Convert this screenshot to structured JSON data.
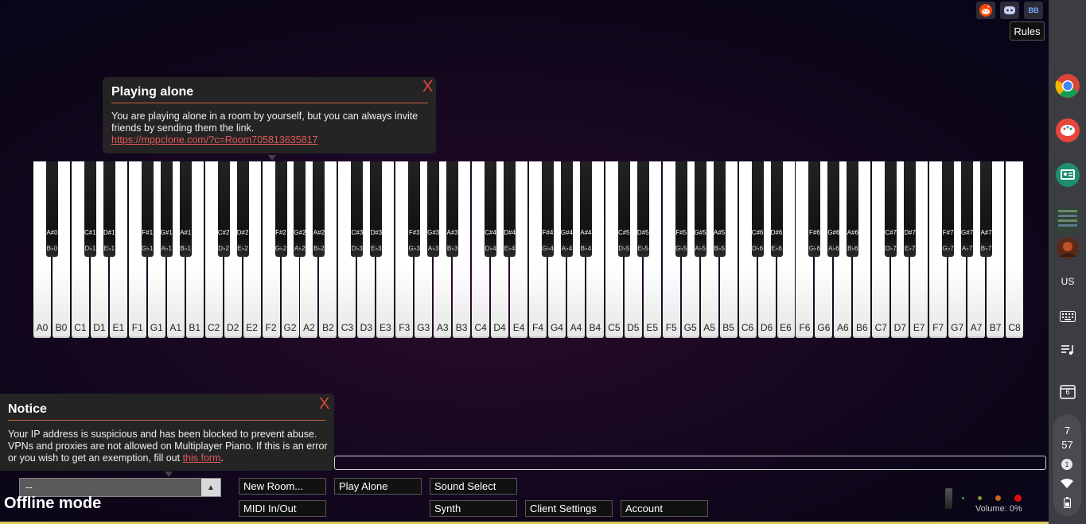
{
  "rules_label": "Rules",
  "top_icons": [
    "reddit-icon",
    "discord-icon",
    "bb-icon"
  ],
  "top_icons_bb_text": "BB",
  "popup_playing_alone": {
    "title": "Playing alone",
    "close": "X",
    "text": "You are playing alone in a room by yourself, but you can always invite friends by sending them the link.",
    "link": "https://mppclone.com/?c=Room705813635817"
  },
  "popup_notice": {
    "title": "Notice",
    "close": "X",
    "text": "Your IP address is suspicious and has been blocked to prevent abuse. VPNs and proxies are not allowed on Multiplayer Piano. If this is an error or you wish to get an exemption, fill out",
    "link": "this form",
    "after": "."
  },
  "room_select": {
    "value": "--"
  },
  "offline_text": "Offline mode",
  "buttons": {
    "new_room": "New Room...",
    "play_alone": "Play Alone",
    "sound_select": "Sound Select",
    "midi": "MIDI In/Out",
    "synth": "Synth",
    "client_settings": "Client Settings",
    "account": "Account"
  },
  "volume_label": "Volume: 0%",
  "volume_level": 0,
  "piano": {
    "white_keys": [
      "A0",
      "B0",
      "C1",
      "D1",
      "E1",
      "F1",
      "G1",
      "A1",
      "B1",
      "C2",
      "D2",
      "E2",
      "F2",
      "G2",
      "A2",
      "B2",
      "C3",
      "D3",
      "E3",
      "F3",
      "G3",
      "A3",
      "B3",
      "C4",
      "D4",
      "E4",
      "F4",
      "G4",
      "A4",
      "B4",
      "C5",
      "D5",
      "E5",
      "F5",
      "G5",
      "A5",
      "B5",
      "C6",
      "D6",
      "E6",
      "F6",
      "G6",
      "A6",
      "B6",
      "C7",
      "D7",
      "E7",
      "F7",
      "G7",
      "A7",
      "B7",
      "C8"
    ],
    "black_keys": [
      {
        "sharp": "A#0",
        "flat": "B♭0"
      },
      {
        "sharp": "C#1",
        "flat": "D♭1"
      },
      {
        "sharp": "D#1",
        "flat": "E♭1"
      },
      {
        "sharp": "F#1",
        "flat": "G♭1"
      },
      {
        "sharp": "G#1",
        "flat": "A♭1"
      },
      {
        "sharp": "A#1",
        "flat": "B♭1"
      },
      {
        "sharp": "C#2",
        "flat": "D♭2"
      },
      {
        "sharp": "D#2",
        "flat": "E♭2"
      },
      {
        "sharp": "F#2",
        "flat": "G♭2"
      },
      {
        "sharp": "G#2",
        "flat": "A♭2"
      },
      {
        "sharp": "A#2",
        "flat": "B♭2"
      },
      {
        "sharp": "C#3",
        "flat": "D♭3"
      },
      {
        "sharp": "D#3",
        "flat": "E♭3"
      },
      {
        "sharp": "F#3",
        "flat": "G♭3"
      },
      {
        "sharp": "G#3",
        "flat": "A♭3"
      },
      {
        "sharp": "A#3",
        "flat": "B♭3"
      },
      {
        "sharp": "C#4",
        "flat": "D♭4"
      },
      {
        "sharp": "D#4",
        "flat": "E♭4"
      },
      {
        "sharp": "F#4",
        "flat": "G♭4"
      },
      {
        "sharp": "G#4",
        "flat": "A♭4"
      },
      {
        "sharp": "A#4",
        "flat": "B♭4"
      },
      {
        "sharp": "C#5",
        "flat": "D♭5"
      },
      {
        "sharp": "D#5",
        "flat": "E♭5"
      },
      {
        "sharp": "F#5",
        "flat": "G♭5"
      },
      {
        "sharp": "G#5",
        "flat": "A♭5"
      },
      {
        "sharp": "A#5",
        "flat": "B♭5"
      },
      {
        "sharp": "C#6",
        "flat": "D♭6"
      },
      {
        "sharp": "D#6",
        "flat": "E♭6"
      },
      {
        "sharp": "F#6",
        "flat": "G♭6"
      },
      {
        "sharp": "G#6",
        "flat": "A♭6"
      },
      {
        "sharp": "A#6",
        "flat": "B♭6"
      },
      {
        "sharp": "C#7",
        "flat": "D♭7"
      },
      {
        "sharp": "D#7",
        "flat": "E♭7"
      },
      {
        "sharp": "F#7",
        "flat": "G♭7"
      },
      {
        "sharp": "G#7",
        "flat": "A♭7"
      },
      {
        "sharp": "A#7",
        "flat": "B♭7"
      }
    ]
  },
  "shelf": {
    "apps": [
      "chrome-icon",
      "paint-palette-icon",
      "classroom-icon",
      "files-thumbnail-icon",
      "avatar-icon"
    ],
    "ime": "US",
    "keyboard_icon": "keyboard-icon",
    "media_icon": "playlist-icon",
    "calendar_day": "6",
    "time_hour": "7",
    "time_minute": "57",
    "notification_count": "1"
  },
  "colors": {
    "accent_red": "#e0483c",
    "rule_orange": "#c9603a",
    "link_pink": "#e0575a"
  }
}
